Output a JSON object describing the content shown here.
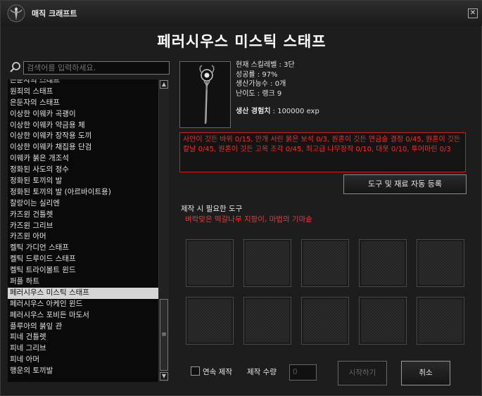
{
  "window": {
    "title": "매직 크래프트",
    "close_label": "✕",
    "heading": "페러시우스 미스틱 스태프"
  },
  "search": {
    "placeholder": "검색어를 입력하세요."
  },
  "recipe_list": {
    "items": [
      "은둔자의 스태프",
      "원죄의 스태프",
      "은둔자의 스태프",
      "이상한 이웨카 곡괭이",
      "이상한 이웨카 약금용 체",
      "이상한 이웨카 장작용 도끼",
      "이상한 이웨카 채집용 단검",
      "이웨카 붉은 개조석",
      "정화된 사도의 정수",
      "정화된 토끼의 발",
      "정화된 토끼의 발 (아르바이트용)",
      "찰랑이는 실리엔",
      "카즈윈 건틀렛",
      "카즈윈 그리브",
      "카즈윈 아머",
      "켈틱 가디언 스태프",
      "켈틱 드루이드 스태프",
      "켈틱 트라이볼트 윈드",
      "퍼플 하트",
      "페러시우스 미스틱 스태프",
      "페러시우스 아케인 윈드",
      "페러시우스 포비든 마도서",
      "플루아의 붉잎 관",
      "피네 건틀렛",
      "피네 그리브",
      "피네 아머",
      "행운의 토끼발"
    ],
    "selected_index": 19,
    "scroll_up": "▲",
    "scroll_down": "▼",
    "thumb_grip": "≡"
  },
  "item_info": {
    "skill_level": "현재 스킬레벨 : 3단",
    "success_rate": "성공률 : 97%",
    "craftable": "생산가능수 : 0개",
    "difficulty": "난이도 : 랭크 9",
    "exp_label": "생산 경험치",
    "exp_value": " : 100000 exp"
  },
  "materials_text": "사안이 깃든 바위 0/15, 안개 서린 붉은 보석 0/3, 원혼이 깃든 연금술 결정 0/45, 원혼이 깃든 칼날 0/45, 원혼이 깃든 고목 조각 0/45, 최고급 나무장작 0/10, 대못 0/10, 투어마린 0/3",
  "buttons": {
    "auto_register": "도구 및 재료 자동 등록",
    "start": "시작하기",
    "cancel": "취소"
  },
  "tools": {
    "label": "제작 시 필요한 도구",
    "list": "벼락맞은 떡갈나무 지팡이, 마법의 기마솥"
  },
  "bottom": {
    "continuous_label": "연속 제작",
    "continuous_checked": false,
    "quantity_label": "제작 수량",
    "quantity_value": "0"
  },
  "colors": {
    "required_text": "#ff2a2a",
    "selected_row": "#d6d6d6"
  }
}
